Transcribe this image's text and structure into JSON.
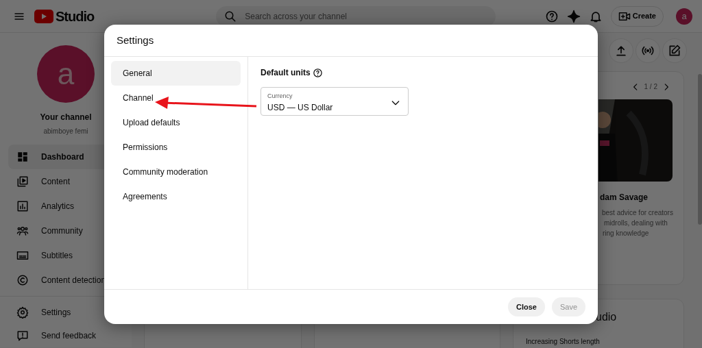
{
  "header": {
    "logo_text": "Studio",
    "search": {
      "placeholder": "Search across your channel"
    },
    "create_label": "Create",
    "avatar_letter": "a"
  },
  "sidebar": {
    "avatar_letter": "a",
    "channel_title": "Your channel",
    "channel_name": "abimboye femi",
    "items": [
      {
        "label": "Dashboard",
        "selected": true
      },
      {
        "label": "Content",
        "selected": false
      },
      {
        "label": "Analytics",
        "selected": false
      },
      {
        "label": "Community",
        "selected": false
      },
      {
        "label": "Subtitles",
        "selected": false
      },
      {
        "label": "Content detection",
        "selected": false
      }
    ],
    "footer_items": [
      {
        "label": "Settings",
        "selected": false
      },
      {
        "label": "Send feedback",
        "selected": false
      }
    ]
  },
  "dashboard": {
    "pager": "1 / 2",
    "card_title": "dam Savage",
    "card_lines": [
      "best advice for creators",
      "midrolls, dealing with",
      "ring knowledge"
    ],
    "second_card_title": "udio",
    "second_card_line": "Increasing Shorts length"
  },
  "dialog": {
    "title": "Settings",
    "nav": [
      {
        "label": "General",
        "selected": true
      },
      {
        "label": "Channel",
        "selected": false
      },
      {
        "label": "Upload defaults",
        "selected": false
      },
      {
        "label": "Permissions",
        "selected": false
      },
      {
        "label": "Community moderation",
        "selected": false
      },
      {
        "label": "Agreements",
        "selected": false
      }
    ],
    "section_title": "Default units",
    "currency": {
      "label": "Currency",
      "value": "USD — US Dollar"
    },
    "buttons": [
      {
        "label": "Close",
        "disabled": false
      },
      {
        "label": "Save",
        "disabled": true
      }
    ]
  }
}
